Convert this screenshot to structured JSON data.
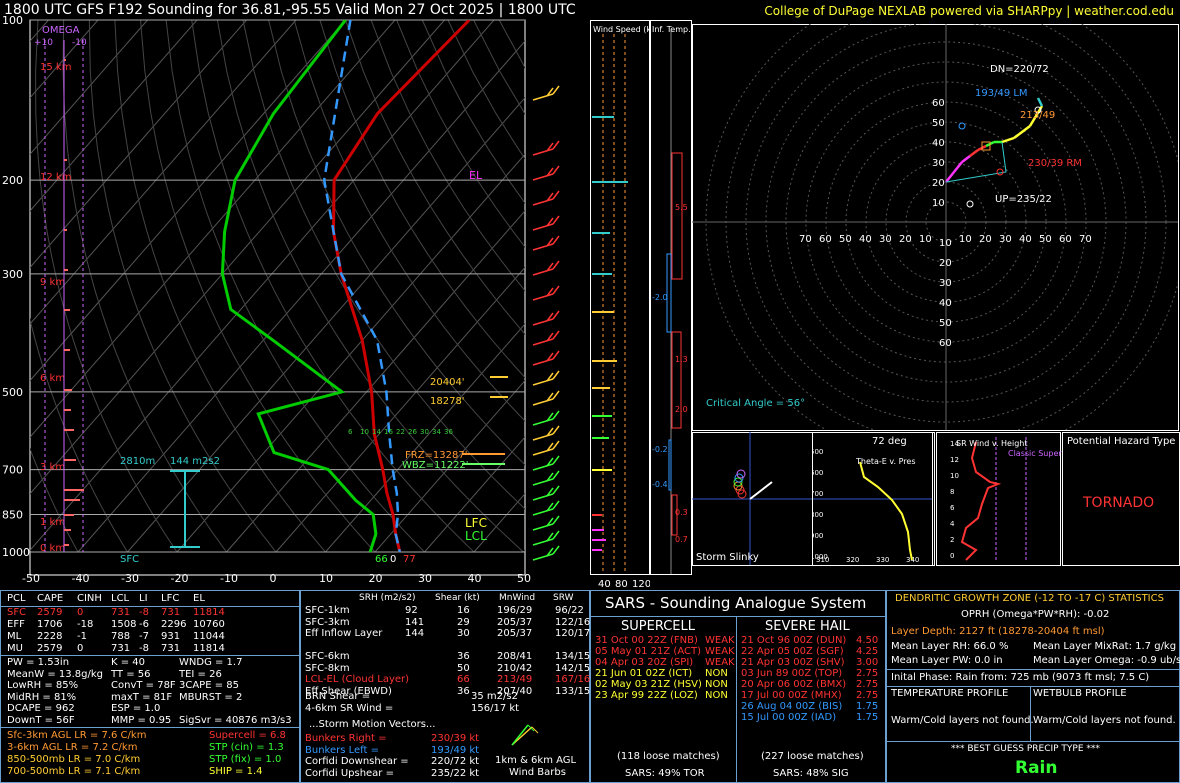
{
  "header": {
    "title": "1800 UTC GFS F192 Sounding for 36.81,-95.55 Valid  Mon 27 Oct 2025 | 1800 UTC",
    "credit": "College of DuPage NEXLAB powered via SHARPpy | weather.cod.edu"
  },
  "skewt": {
    "omega_label": "OMEGA",
    "omega_ticks": [
      "+10",
      "-10"
    ],
    "pressure_levels": [
      "100",
      "200",
      "300",
      "500",
      "700",
      "850",
      "1000"
    ],
    "temp_ticks": [
      "-50",
      "-40",
      "-30",
      "-20",
      "-10",
      "0",
      "10",
      "20",
      "30",
      "40",
      "50"
    ],
    "height_labels": [
      "15 km",
      "12 km",
      "9 km",
      "6 km",
      "3 km",
      "1 km",
      "0 km"
    ],
    "el_label": "EL",
    "lfc_label": "LFC",
    "lcl_label": "LCL",
    "sfc_label": "SFC",
    "label_20404": "20404'",
    "label_18278": "18278'",
    "frz_label": "FRZ=13287'",
    "wbz_label": "WBZ=11222'",
    "layer_2810": "2810m",
    "layer_srh": "144 m2s2",
    "sfc_td": "66",
    "sfc_zero": "0",
    "sfc_t": "77",
    "mixratio_ticks": [
      "6",
      "10",
      "14",
      "16",
      "22",
      "26",
      "30",
      "34",
      "36"
    ]
  },
  "wind_speed_panel": {
    "label": "Wind Speed (knots)",
    "ticks": [
      "40",
      "80",
      "120"
    ]
  },
  "inftemp_panel": {
    "label": "Inf. Temp. Adv. (C/hr)",
    "values": [
      "5.5",
      "-2.0",
      "1.3",
      "2.0",
      "-0.2",
      "-0.4",
      "0.3",
      "0.7"
    ]
  },
  "hodograph": {
    "rings_y": [
      "60",
      "50",
      "40",
      "30",
      "20",
      "10"
    ],
    "rings_x": [
      "70",
      "60",
      "50",
      "40",
      "30",
      "20",
      "10",
      "10",
      "20",
      "30",
      "40",
      "50",
      "60",
      "70"
    ],
    "rings_y_low": [
      "10",
      "20",
      "30",
      "40",
      "50",
      "60"
    ],
    "dn_label": "DN=220/72",
    "lm_label": "193/49 LM",
    "mean_label": "213/49",
    "rm_label": "230/39 RM",
    "up_label": "UP=235/22",
    "critical_angle": "Critical Angle = 56°"
  },
  "slinky": {
    "deg_label": "72 deg",
    "name": "Storm Slinky",
    "ticks": [
      "500",
      "600",
      "700"
    ]
  },
  "thetae": {
    "title": "Theta-E v. Pres",
    "y_ticks": [
      "500",
      "600",
      "700",
      "800",
      "900",
      "1000"
    ],
    "x_ticks": [
      "310",
      "320",
      "330",
      "340"
    ]
  },
  "srwind": {
    "title": "SR Wind v. Height",
    "y_ticks": [
      "14",
      "12",
      "10",
      "8",
      "6",
      "4",
      "2",
      "0"
    ],
    "classic": "Classic Supercell"
  },
  "hazard": {
    "title": "Potential Hazard Type",
    "value": "TORNADO"
  },
  "parcel_table": {
    "headers": [
      "PCL",
      "CAPE",
      "CINH",
      "LCL",
      "LI",
      "LFC",
      "EL"
    ],
    "rows": [
      [
        "SFC",
        "2579",
        "0",
        "731",
        "-8",
        "731",
        "11814"
      ],
      [
        "EFF",
        "1706",
        "-18",
        "1508",
        "-6",
        "2296",
        "10760"
      ],
      [
        "ML",
        "2228",
        "-1",
        "788",
        "-7",
        "931",
        "11044"
      ],
      [
        "MU",
        "2579",
        "0",
        "731",
        "-8",
        "731",
        "11814"
      ]
    ]
  },
  "thermo_indices": [
    [
      "PW = 1.53in",
      "K = 40",
      "WNDG = 1.7"
    ],
    [
      "MeanW = 13.8g/kg",
      "TT = 56",
      "TEI = 26"
    ],
    [
      "LowRH = 85%",
      "ConvT = 78F",
      "3CAPE = 85"
    ],
    [
      "MidRH = 81%",
      "maxT = 81F",
      "MBURST = 2"
    ],
    [
      "DCAPE = 962",
      "ESP = 1.0",
      ""
    ],
    [
      "DownT = 56F",
      "MMP = 0.95",
      "SigSvr = 40876 m3/s3"
    ]
  ],
  "lapse_rates": [
    "Sfc-3km AGL LR = 7.6 C/km",
    "3-6km AGL LR = 7.2 C/km",
    "850-500mb LR = 7.0 C/km",
    "700-500mb LR = 7.1 C/km"
  ],
  "composites": [
    "Supercell = 6.8",
    "STP (cin) = 1.3",
    "STP (fix) = 1.0",
    "SHIP = 1.4"
  ],
  "kinematics": {
    "headers": [
      "SRH (m2/s2)",
      "Shear (kt)",
      "MnWind",
      "SRW"
    ],
    "rows": [
      [
        "SFC-1km",
        "92",
        "16",
        "196/29",
        "96/22"
      ],
      [
        "SFC-3km",
        "141",
        "29",
        "205/37",
        "122/16"
      ],
      [
        "Eff Inflow Layer",
        "144",
        "30",
        "205/37",
        "120/17"
      ],
      [
        "",
        "",
        "",
        "",
        ""
      ],
      [
        "SFC-6km",
        "",
        "36",
        "208/41",
        "134/15"
      ],
      [
        "SFC-8km",
        "",
        "50",
        "210/42",
        "142/15"
      ],
      [
        "LCL-EL (Cloud Layer)",
        "",
        "66",
        "213/49",
        "167/16"
      ],
      [
        "Eff Shear (EBWD)",
        "",
        "36",
        "207/40",
        "133/15"
      ]
    ],
    "brn_shear": "BRN Shear =",
    "brn_shear_val": "35 m2/s2",
    "sr_wind": "4-6km SR Wind =",
    "sr_wind_val": "156/17 kt",
    "storm_motion_title": "...Storm Motion Vectors...",
    "motions": [
      [
        "Bunkers Right =",
        "230/39 kt"
      ],
      [
        "Bunkers Left =",
        "193/49 kt"
      ],
      [
        "Corfidi Downshear =",
        "220/72 kt"
      ],
      [
        "Corfidi Upshear =",
        "235/22 kt"
      ]
    ],
    "barb_caption_1": "1km & 6km AGL",
    "barb_caption_2": "Wind Barbs"
  },
  "sars": {
    "title": "SARS - Sounding Analogue System",
    "supercell_title": "SUPERCELL",
    "hail_title": "SEVERE HAIL",
    "supercell": [
      [
        "31 Oct 00 22Z (FNB)",
        "WEAK"
      ],
      [
        "05 May 01 21Z (ACT)",
        "WEAK"
      ],
      [
        "04 Apr 03 20Z (SPI)",
        "WEAK"
      ],
      [
        "21 Jun 01 02Z (ICT)",
        "NON"
      ],
      [
        "02 May 03 21Z (HSV)",
        "NON"
      ],
      [
        "23 Apr 99 22Z (LOZ)",
        "NON"
      ]
    ],
    "hail": [
      [
        "21 Oct 96 00Z (DUN)",
        "4.50"
      ],
      [
        "22 Apr 05 00Z (SGF)",
        "4.25"
      ],
      [
        "21 Apr 03 00Z (SHV)",
        "3.00"
      ],
      [
        "03 Jun 89 00Z (TOP)",
        "2.75"
      ],
      [
        "20 Apr 06 00Z (BMX)",
        "2.75"
      ],
      [
        "17 Jul 00 00Z (MHX)",
        "2.75"
      ],
      [
        "26 Aug 04 00Z (BIS)",
        "1.75"
      ],
      [
        "15 Jul 00 00Z (IAD)",
        "1.75"
      ]
    ],
    "supercell_matches": "(118 loose matches)",
    "hail_matches": "(227 loose matches)",
    "supercell_prob": "SARS: 49% TOR",
    "hail_prob": "SARS: 48% SIG"
  },
  "dgz": {
    "title": "DENDRITIC GROWTH ZONE (-12 TO -17 C) STATISTICS",
    "oprh": "OPRH (Omega*PW*RH): -0.02",
    "layer_depth": "Layer Depth: 2127 ft (18278-20404 ft msl)",
    "mean_rh": "Mean Layer RH: 66.0 %",
    "mean_mixrat": "Mean Layer MixRat: 1.7 g/kg",
    "mean_pw": "Mean Layer PW: 0.0 in",
    "mean_omega": "Mean Layer Omega: -0.9 ub/s",
    "initial_phase": "Inital Phase: Rain from: 725 mb (9073 ft msl; 7.5 C)",
    "temp_profile": "TEMPERATURE PROFILE",
    "wetbulb_profile": "WETBULB PROFILE",
    "warm_cold_1": "Warm/Cold layers not found.",
    "warm_cold_2": "Warm/Cold layers not found.",
    "best_guess_title": "*** BEST GUESS PRECIP TYPE ***",
    "best_guess": "Rain"
  },
  "chart_data": {
    "type": "line",
    "title": "1800 UTC GFS F192 Sounding for 36.81,-95.55 Valid  Mon 27 Oct 2025 | 1800 UTC",
    "xlabel": "",
    "ylabel": "",
    "pressure_axis": [
      100,
      200,
      300,
      500,
      700,
      850,
      1000
    ],
    "temp_axis_range": [
      -50,
      50
    ],
    "series": [
      {
        "name": "",
        "color": "#cc0000",
        "points": [
          [
            100,
            -55
          ],
          [
            150,
            -57
          ],
          [
            200,
            -54
          ],
          [
            250,
            -45
          ],
          [
            300,
            -36
          ],
          [
            400,
            -20
          ],
          [
            500,
            -9
          ],
          [
            600,
            -1
          ],
          [
            700,
            7
          ],
          [
            775,
            12
          ],
          [
            850,
            17
          ],
          [
            925,
            21
          ],
          [
            1000,
            25
          ]
        ]
      },
      {
        "name": "",
        "color": "#00cc00",
        "points": [
          [
            100,
            -80
          ],
          [
            150,
            -78
          ],
          [
            200,
            -74
          ],
          [
            250,
            -67
          ],
          [
            300,
            -60
          ],
          [
            350,
            -52
          ],
          [
            400,
            -38
          ],
          [
            500,
            -15
          ],
          [
            550,
            -28
          ],
          [
            650,
            -18
          ],
          [
            700,
            -4
          ],
          [
            800,
            7
          ],
          [
            850,
            13
          ],
          [
            925,
            17
          ],
          [
            1000,
            19
          ]
        ]
      },
      {
        "name": "",
        "color": "#3399ff",
        "points": [
          [
            100,
            -79
          ],
          [
            200,
            -56
          ],
          [
            300,
            -36
          ],
          [
            400,
            -17
          ],
          [
            500,
            -6
          ],
          [
            600,
            2
          ],
          [
            700,
            9
          ],
          [
            775,
            14
          ],
          [
            850,
            18
          ],
          [
            925,
            21
          ],
          [
            1000,
            25
          ]
        ]
      }
    ],
    "hodograph_points": [
      [
        0,
        20
      ],
      [
        4,
        25
      ],
      [
        8,
        30
      ],
      [
        12,
        33
      ],
      [
        16,
        36
      ],
      [
        20,
        38
      ],
      [
        24,
        40
      ],
      [
        28,
        40
      ],
      [
        34,
        42
      ],
      [
        42,
        48
      ],
      [
        48,
        58
      ],
      [
        46,
        62
      ]
    ]
  }
}
